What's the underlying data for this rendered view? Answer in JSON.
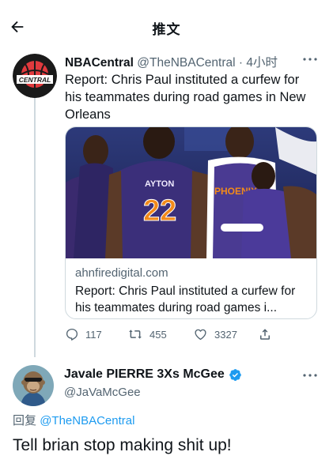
{
  "header": {
    "title": "推文",
    "back_icon": "arrow-left-icon"
  },
  "original_tweet": {
    "display_name": "NBACentral",
    "handle": "@TheNBACentral",
    "separator": "·",
    "time": "4小时",
    "avatar_text": "CENTRAL",
    "text": "Report: Chris Paul instituted a curfew for his teammates during road games in New Orleans",
    "card": {
      "domain": "ahnfiredigital.com",
      "title": "Report: Chris Paul instituted a curfew for his teammates during road games i...",
      "image_jersey_texts": [
        "AYTON",
        "22",
        "PHOENIX"
      ]
    },
    "actions": {
      "replies": "117",
      "retweets": "455",
      "likes": "3327"
    }
  },
  "reply_tweet": {
    "display_name": "Javale PIERRE 3Xs McGee",
    "handle": "@JaVaMcGee",
    "replying_label": "回复",
    "replying_to": "@TheNBACentral",
    "text": "Tell brian stop making shit up!"
  },
  "colors": {
    "accent": "#1d9bf0",
    "text": "#0f1419",
    "muted": "#536471",
    "border": "#cfd9de"
  }
}
